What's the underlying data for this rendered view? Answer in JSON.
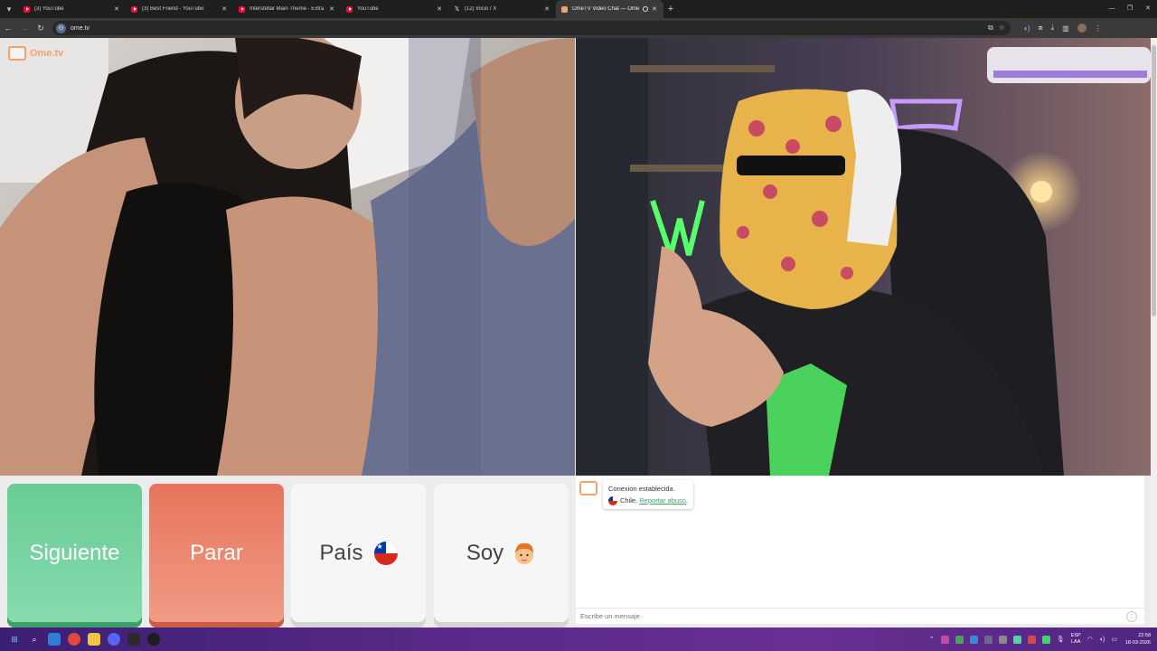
{
  "browser": {
    "tabs": [
      {
        "title": "(3) YouTube",
        "icon": "youtube-icon",
        "active": false
      },
      {
        "title": "(3) Best Friend - YouTube",
        "icon": "youtube-icon",
        "active": false
      },
      {
        "title": "Interstellar Main Theme - Extra",
        "icon": "youtube-icon",
        "active": false
      },
      {
        "title": "YouTube",
        "icon": "youtube-icon",
        "active": false
      },
      {
        "title": "(12) Inicio / X",
        "icon": "x-icon",
        "active": false
      },
      {
        "title": "OmeTV Video Chat — Ome",
        "icon": "ometv-icon",
        "active": true
      }
    ],
    "url": "ome.tv"
  },
  "app": {
    "logo_text": "Ome.tv"
  },
  "controls": {
    "next_label": "Siguiente",
    "stop_label": "Parar",
    "country_label": "País",
    "country_flag": "chile-flag-icon",
    "gender_label": "Soy",
    "gender_icon": "boy-emoji-icon"
  },
  "chat": {
    "status_text": "Conexion establecida.",
    "country_text": "Chile.",
    "report_link": "Reportar abuso",
    "report_suffix": ".",
    "message_placeholder": "Escribe un mensaje"
  },
  "taskbar": {
    "lang_top": "ESP",
    "lang_bottom": "LAA",
    "time": "22:58",
    "date": "18-03-2026"
  },
  "colors": {
    "next_button": "#68cc96",
    "stop_button": "#e7745c",
    "brand_orange": "#f2a36a",
    "link_green": "#3aa36a"
  }
}
